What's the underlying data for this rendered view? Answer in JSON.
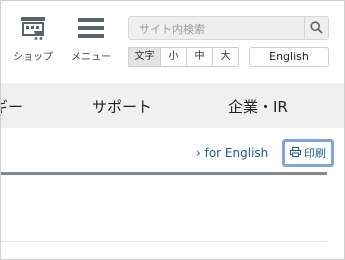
{
  "header": {
    "shop_label": "ショップ",
    "menu_label": "メニュー",
    "search": {
      "placeholder": "サイト内検索"
    },
    "font_size": {
      "label": "文字",
      "options": [
        "小",
        "中",
        "大"
      ]
    },
    "language_button": "English"
  },
  "nav": {
    "items": [
      "ギー",
      "サポート",
      "企業・IR"
    ]
  },
  "utility": {
    "for_english": "› for English",
    "print_label": "印刷"
  },
  "colors": {
    "nav_background": "#f0f0f0",
    "link": "#1d5a9a",
    "focus_outline": "#7fa6dc",
    "rule": "#7f8a93"
  },
  "icons": [
    "shop-cart-icon",
    "hamburger-menu-icon",
    "search-icon",
    "print-icon"
  ]
}
